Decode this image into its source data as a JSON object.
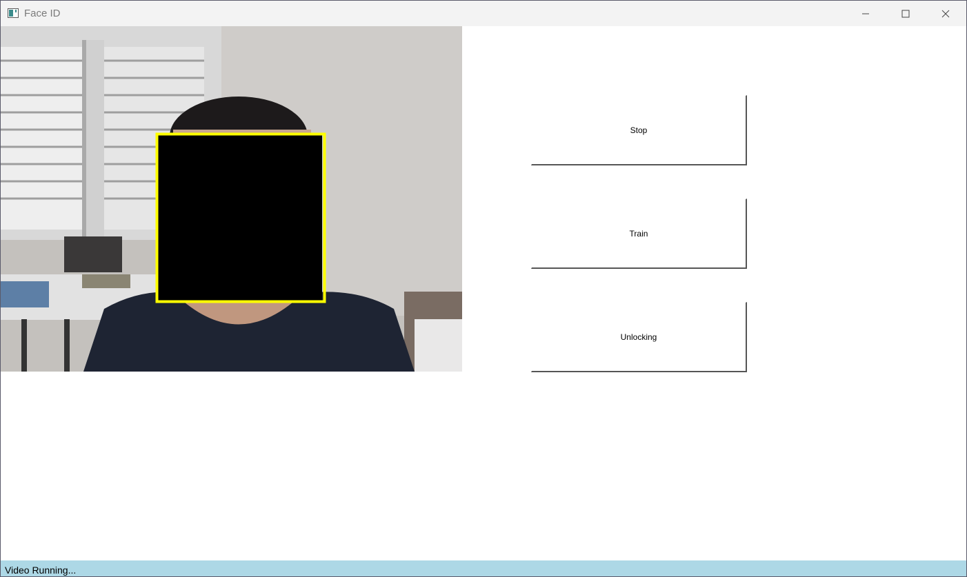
{
  "window": {
    "title": "Face ID",
    "controls": {
      "minimize": "minimize-icon",
      "maximize": "maximize-icon",
      "close": "close-icon"
    }
  },
  "video": {
    "face_box_color": "#ffff00",
    "face_mask_color": "#000000"
  },
  "buttons": {
    "stop_label": "Stop",
    "train_label": "Train",
    "unlock_label": "Unlocking"
  },
  "status": {
    "text": "Video Running...",
    "background": "#add8e6"
  }
}
